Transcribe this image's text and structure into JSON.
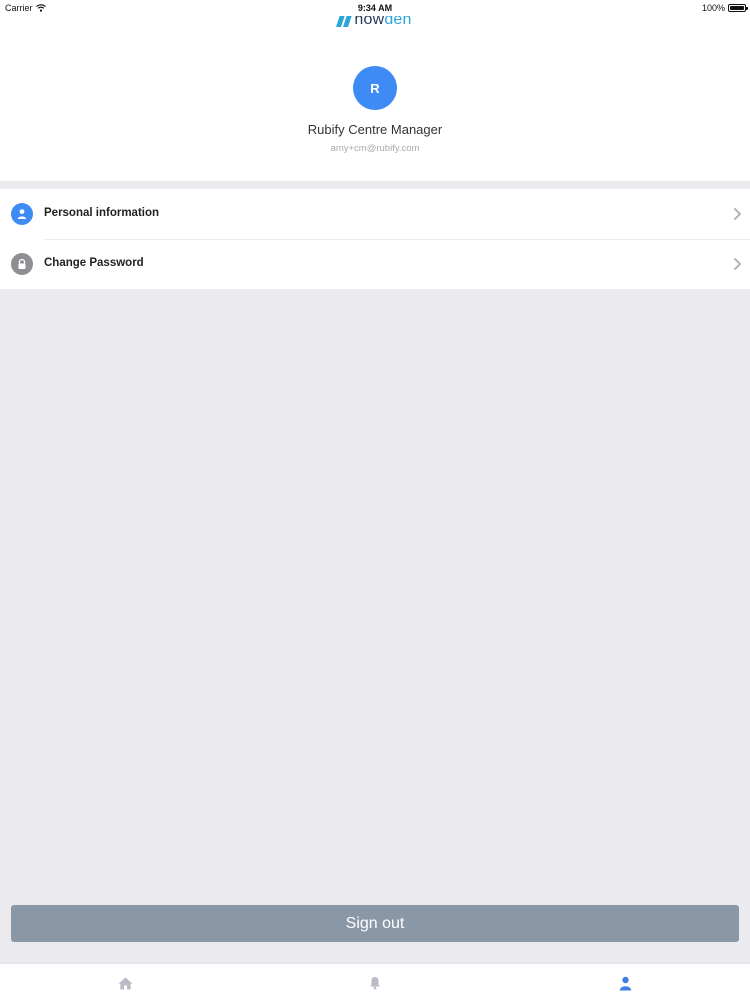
{
  "status_bar": {
    "carrier": "Carrier",
    "time": "9:34 AM",
    "battery": "100%"
  },
  "brand": {
    "name_part1": "how",
    "name_part2": "den",
    "accent": "#29a7d8",
    "dark": "#2a3b57"
  },
  "profile": {
    "initial": "R",
    "name": "Rubify Centre Manager",
    "email": "amy+cm@rubify.com",
    "avatar_color": "#3f8bf6"
  },
  "menu": {
    "items": [
      {
        "label": "Personal information",
        "icon": "person-icon",
        "icon_color": "#3f8bf6"
      },
      {
        "label": "Change Password",
        "icon": "lock-icon",
        "icon_color": "#8e8e93"
      }
    ]
  },
  "actions": {
    "sign_out": "Sign out",
    "sign_out_color": "#8a97a7"
  },
  "tab_bar": {
    "tabs": [
      {
        "icon": "home-icon",
        "active": false
      },
      {
        "icon": "bell-icon",
        "active": false
      },
      {
        "icon": "profile-icon",
        "active": true
      }
    ],
    "active_color": "#3f7fe0",
    "inactive_color": "#b8bcc4"
  }
}
